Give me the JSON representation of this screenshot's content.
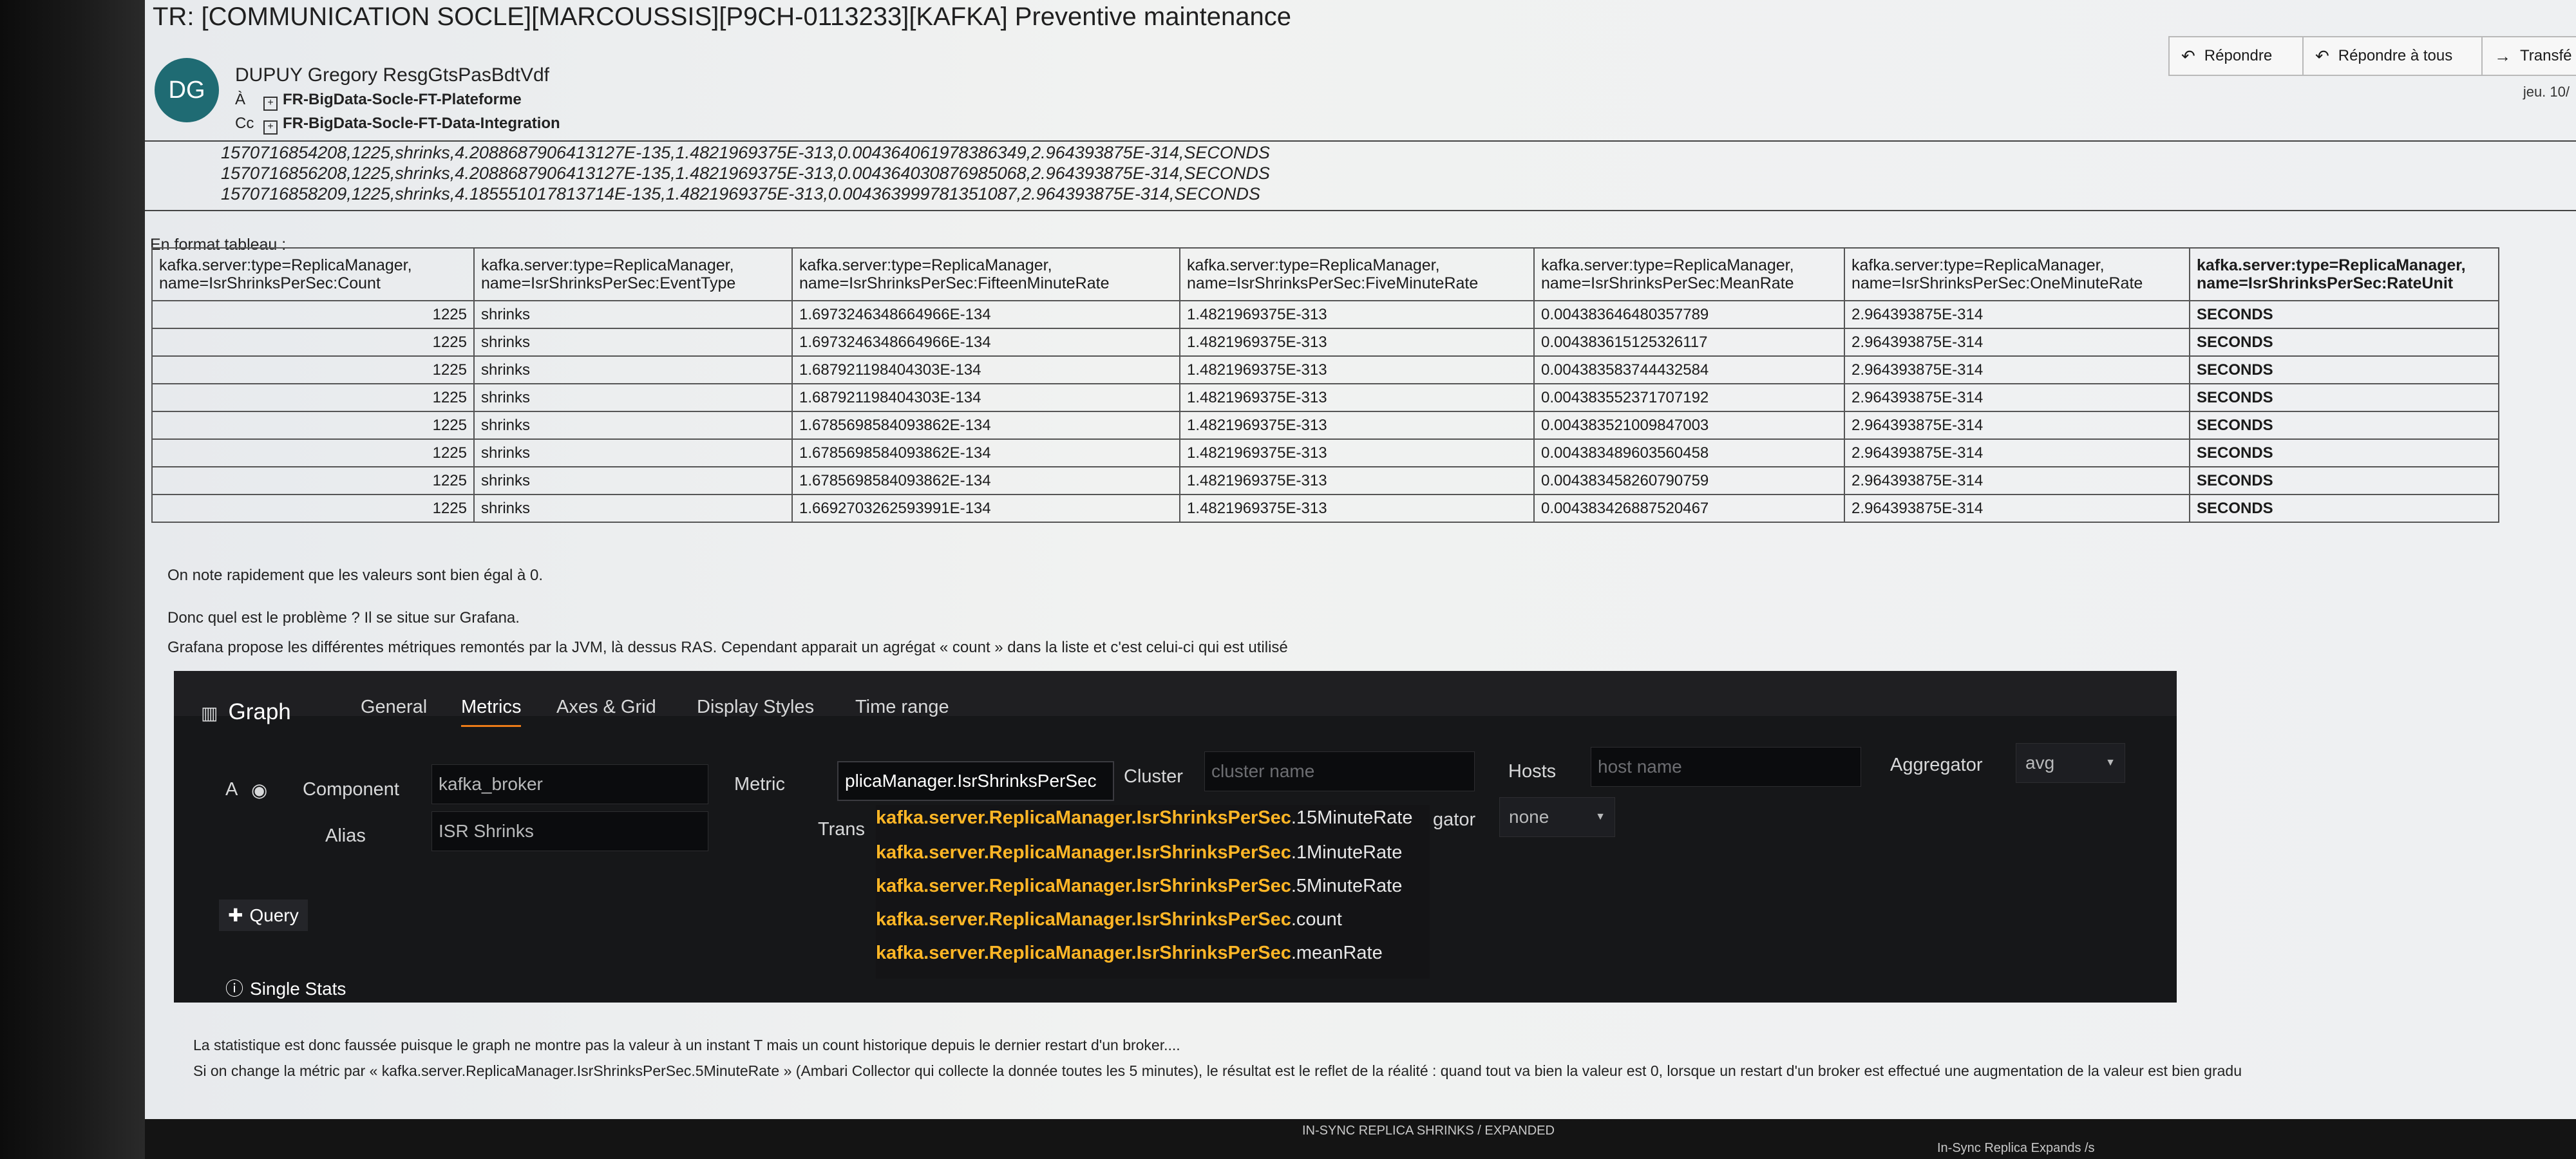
{
  "email": {
    "subject": "TR: [COMMUNICATION SOCLE][MARCOUSSIS][P9CH-0113233][KAFKA] Preventive maintenance",
    "avatar_initials": "DG",
    "sender": "DUPUY Gregory ResgGtsPasBdtVdf",
    "to_label": "À",
    "to": "FR-BigData-Socle-FT-Plateforme",
    "cc_label": "Cc",
    "cc": "FR-BigData-Socle-FT-Data-Integration",
    "date": "jeu. 10/",
    "actions": {
      "reply": "Répondre",
      "reply_all": "Répondre à tous",
      "forward": "Transfé"
    }
  },
  "quoted_lines": [
    "1570716854208,1225,shrinks,4.2088687906413127E-135,1.4821969375E-313,0.004364061978386349,2.964393875E-314,SECONDS",
    "1570716856208,1225,shrinks,4.2088687906413127E-135,1.4821969375E-313,0.004364030876985068,2.964393875E-314,SECONDS",
    "1570716858209,1225,shrinks,4.185551017813714E-135,1.4821969375E-313,0.004363999781351087,2.964393875E-314,SECONDS"
  ],
  "table_intro": "En format tableau :",
  "table": {
    "headers": [
      [
        "kafka.server:type=ReplicaManager,",
        "name=IsrShrinksPerSec:Count"
      ],
      [
        "kafka.server:type=ReplicaManager,",
        "name=IsrShrinksPerSec:EventType"
      ],
      [
        "kafka.server:type=ReplicaManager,",
        "name=IsrShrinksPerSec:FifteenMinuteRate"
      ],
      [
        "kafka.server:type=ReplicaManager,",
        "name=IsrShrinksPerSec:FiveMinuteRate"
      ],
      [
        "kafka.server:type=ReplicaManager,",
        "name=IsrShrinksPerSec:MeanRate"
      ],
      [
        "kafka.server:type=ReplicaManager,",
        "name=IsrShrinksPerSec:OneMinuteRate"
      ],
      [
        "kafka.server:type=ReplicaManager,",
        "name=IsrShrinksPerSec:RateUnit"
      ]
    ],
    "rows": [
      [
        "1225",
        "shrinks",
        "1.6973246348664966E-134",
        "1.4821969375E-313",
        "0.004383646480357789",
        "2.964393875E-314",
        "SECONDS"
      ],
      [
        "1225",
        "shrinks",
        "1.6973246348664966E-134",
        "1.4821969375E-313",
        "0.004383615125326117",
        "2.964393875E-314",
        "SECONDS"
      ],
      [
        "1225",
        "shrinks",
        "1.687921198404303E-134",
        "1.4821969375E-313",
        "0.004383583744432584",
        "2.964393875E-314",
        "SECONDS"
      ],
      [
        "1225",
        "shrinks",
        "1.687921198404303E-134",
        "1.4821969375E-313",
        "0.004383552371707192",
        "2.964393875E-314",
        "SECONDS"
      ],
      [
        "1225",
        "shrinks",
        "1.6785698584093862E-134",
        "1.4821969375E-313",
        "0.004383521009847003",
        "2.964393875E-314",
        "SECONDS"
      ],
      [
        "1225",
        "shrinks",
        "1.6785698584093862E-134",
        "1.4821969375E-313",
        "0.004383489603560458",
        "2.964393875E-314",
        "SECONDS"
      ],
      [
        "1225",
        "shrinks",
        "1.6785698584093862E-134",
        "1.4821969375E-313",
        "0.004383458260790759",
        "2.964393875E-314",
        "SECONDS"
      ],
      [
        "1225",
        "shrinks",
        "1.6692703262593991E-134",
        "1.4821969375E-313",
        "0.004383426887520467",
        "2.964393875E-314",
        "SECONDS"
      ]
    ]
  },
  "paragraphs": {
    "p1": "On note rapidement que les valeurs sont bien égal à 0.",
    "p2": "Donc quel est le problème ? Il se situe sur Grafana.",
    "p3": "Grafana propose les différentes métriques remontés par la JVM, là dessus RAS. Cependant apparait un agrégat « count » dans la liste et c'est celui-ci qui est utilisé",
    "p4": "La statistique est donc faussée puisque le graph ne montre pas la valeur à un instant T mais un count historique depuis le dernier restart d'un broker....",
    "p5": "Si on change la métric par « kafka.server.ReplicaManager.IsrShrinksPerSec.5MinuteRate » (Ambari Collector qui collecte la donnée toutes les 5 minutes), le résultat est le reflet de la réalité : quand tout va bien la valeur est 0, lorsque un restart d'un broker est effectué une augmentation de la valeur est bien gradu"
  },
  "grafana": {
    "panel_title": "Graph",
    "tabs": [
      "General",
      "Metrics",
      "Axes & Grid",
      "Display Styles",
      "Time range"
    ],
    "active_tab": "Metrics",
    "query_letter": "A",
    "component_label": "Component",
    "component_value": "kafka_broker",
    "alias_label": "Alias",
    "alias_value": "ISR Shrinks",
    "metric_label": "Metric",
    "metric_value": "plicaManager.IsrShrinksPerSec",
    "cluster_label": "Cluster",
    "cluster_placeholder": "cluster name",
    "hosts_label": "Hosts",
    "hosts_placeholder": "host name",
    "aggregator_label": "Aggregator",
    "aggregator_value": "avg",
    "trans_label": "Trans",
    "gator_label": "gator",
    "gator_value": "none",
    "suggestion_prefix": "kafka.server.ReplicaManager.IsrShrinksPerSec",
    "suggestions": [
      ".15MinuteRate",
      ".1MinuteRate",
      ".5MinuteRate",
      ".count",
      ".meanRate"
    ],
    "add_query": "Query",
    "single_stats": "Single Stats"
  },
  "bottom": {
    "panel_title": "IN-SYNC REPLICA SHRINKS / EXPANDED",
    "panel_title_2": "In-Sync Replica Expands /s"
  }
}
